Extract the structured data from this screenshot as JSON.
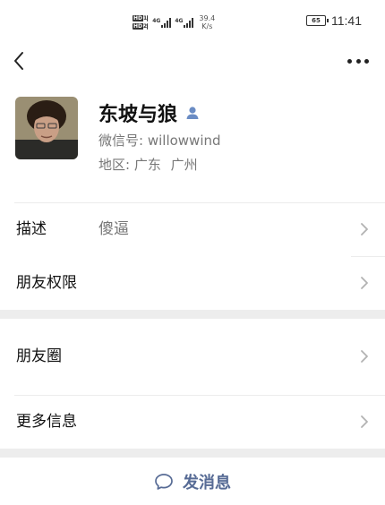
{
  "status_bar": {
    "hd_tags": [
      {
        "label": "HD",
        "suffix": "1"
      },
      {
        "label": "HD",
        "suffix": "2"
      }
    ],
    "signals": [
      {
        "label": "4G"
      },
      {
        "label": "4G"
      }
    ],
    "net_speed_value": "39.4",
    "net_speed_unit": "K/s",
    "battery": "65",
    "time": "11:41"
  },
  "navbar": {
    "back_icon": "chevron-left-icon",
    "more_icon": "ellipsis-icon"
  },
  "profile": {
    "nickname": "东坡与狼",
    "wechat_id_label": "微信号:",
    "wechat_id": "willowwind",
    "region_label": "地区:",
    "region_province": "广东",
    "region_city": "广州",
    "friend_icon": "person-icon"
  },
  "rows": {
    "description": {
      "label": "描述",
      "value": "傻逼"
    },
    "permissions": {
      "label": "朋友权限"
    },
    "moments": {
      "label": "朋友圈"
    },
    "more_info": {
      "label": "更多信息"
    }
  },
  "send_message": {
    "label": "发消息",
    "icon": "chat-bubble-icon"
  },
  "colors": {
    "link": "#576b95",
    "secondary_text": "#777777",
    "gap_band": "#ededed",
    "chevron": "#b2b2b2"
  }
}
